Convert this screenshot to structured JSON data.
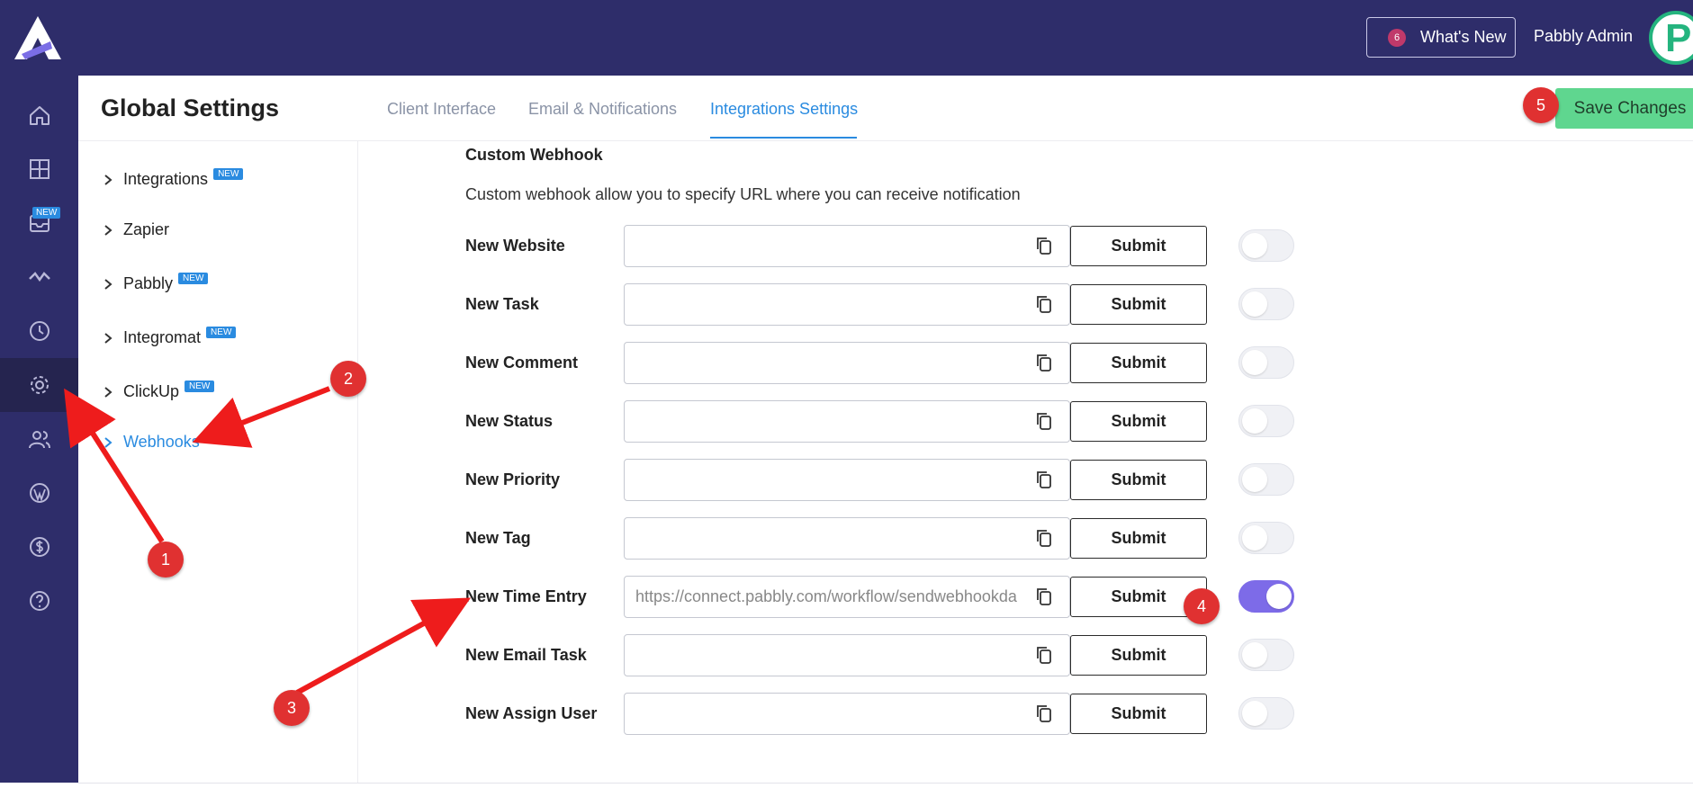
{
  "topbar": {
    "whats_new_count": "6",
    "whats_new_label": "What's New",
    "admin_name": "Pabbly Admin",
    "avatar_letter": "P"
  },
  "sidenav": {
    "items": [
      "home-icon",
      "dashboard-grid-icon",
      "inbox-icon",
      "activity-icon",
      "clock-icon",
      "gear-icon",
      "users-icon",
      "wordpress-icon",
      "dollar-icon",
      "help-icon"
    ],
    "inbox_badge": "NEW",
    "active_item": "gear-icon"
  },
  "page": {
    "title": "Global Settings",
    "save_label": "Save Changes"
  },
  "tabs": [
    {
      "label": "Client Interface",
      "active": false
    },
    {
      "label": "Email & Notifications",
      "active": false
    },
    {
      "label": "Integrations Settings",
      "active": true
    }
  ],
  "menu": {
    "items": [
      {
        "label": "Integrations",
        "badge": "NEW"
      },
      {
        "label": "Zapier",
        "badge": ""
      },
      {
        "label": "Pabbly",
        "badge": "NEW"
      },
      {
        "label": "Integromat",
        "badge": "NEW"
      },
      {
        "label": "ClickUp",
        "badge": "NEW"
      },
      {
        "label": "Webhooks",
        "badge": "",
        "active": true
      }
    ]
  },
  "webhook": {
    "section_title": "Custom Webhook",
    "description": "Custom webhook allow you to specify URL where you can receive notification",
    "submit_label": "Submit",
    "rows": [
      {
        "label": "New Website",
        "value": "",
        "enabled": false
      },
      {
        "label": "New Task",
        "value": "",
        "enabled": false
      },
      {
        "label": "New Comment",
        "value": "",
        "enabled": false
      },
      {
        "label": "New Status",
        "value": "",
        "enabled": false
      },
      {
        "label": "New Priority",
        "value": "",
        "enabled": false
      },
      {
        "label": "New Tag",
        "value": "",
        "enabled": false
      },
      {
        "label": "New Time Entry",
        "value": "https://connect.pabbly.com/workflow/sendwebhookda",
        "enabled": true
      },
      {
        "label": "New Email Task",
        "value": "",
        "enabled": false
      },
      {
        "label": "New Assign User",
        "value": "",
        "enabled": false
      }
    ]
  },
  "annotations": [
    "1",
    "2",
    "3",
    "4",
    "5"
  ],
  "colors": {
    "sidebar": "#2e2d6a",
    "accent": "#2a8be0",
    "save": "#5fd68f",
    "toggle_on": "#7d6be8",
    "annotation": "#e03131"
  }
}
